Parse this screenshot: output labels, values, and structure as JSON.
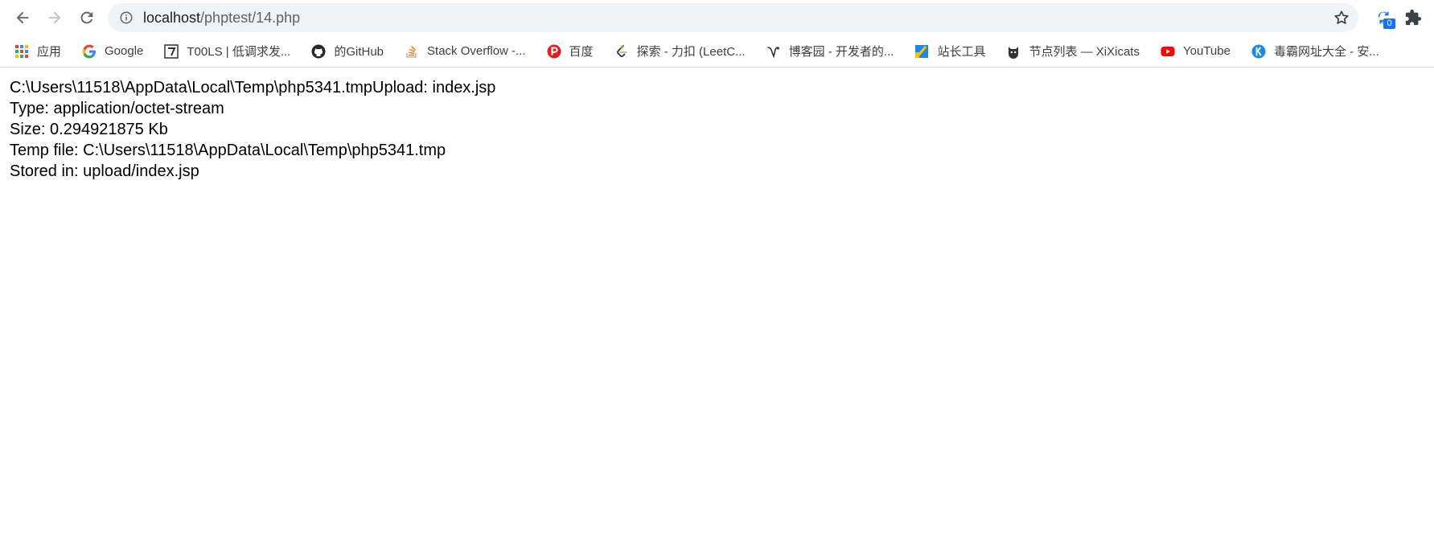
{
  "toolbar": {
    "url_host": "localhost",
    "url_path": "/phptest/14.php",
    "extension_badge": "0"
  },
  "bookmarks": [
    {
      "label": "应用",
      "icon": "apps-grid-icon"
    },
    {
      "label": "Google",
      "icon": "google-icon"
    },
    {
      "label": "T00LS | 低调求发...",
      "icon": "tools-icon"
    },
    {
      "label": "的GitHub",
      "icon": "github-icon"
    },
    {
      "label": "Stack Overflow -...",
      "icon": "stackoverflow-icon"
    },
    {
      "label": "百度",
      "icon": "baidu-icon"
    },
    {
      "label": "探索 - 力扣 (LeetC...",
      "icon": "leetcode-icon"
    },
    {
      "label": "博客园 - 开发者的...",
      "icon": "cnblogs-icon"
    },
    {
      "label": "站长工具",
      "icon": "chinaz-icon"
    },
    {
      "label": "节点列表 — XiXicats",
      "icon": "xixicats-icon"
    },
    {
      "label": "YouTube",
      "icon": "youtube-icon"
    },
    {
      "label": "毒霸网址大全 - 安...",
      "icon": "duba-icon"
    }
  ],
  "page": {
    "lines": [
      "C:\\Users\\11518\\AppData\\Local\\Temp\\php5341.tmpUpload: index.jsp",
      "Type: application/octet-stream",
      "Size: 0.294921875 Kb",
      "Temp file: C:\\Users\\11518\\AppData\\Local\\Temp\\php5341.tmp",
      "Stored in: upload/index.jsp"
    ]
  },
  "colors": {
    "omnibox_bg": "#f1f3f4",
    "badge": "#1a73e8",
    "youtube": "#ff0000",
    "baidu": "#e02020"
  }
}
